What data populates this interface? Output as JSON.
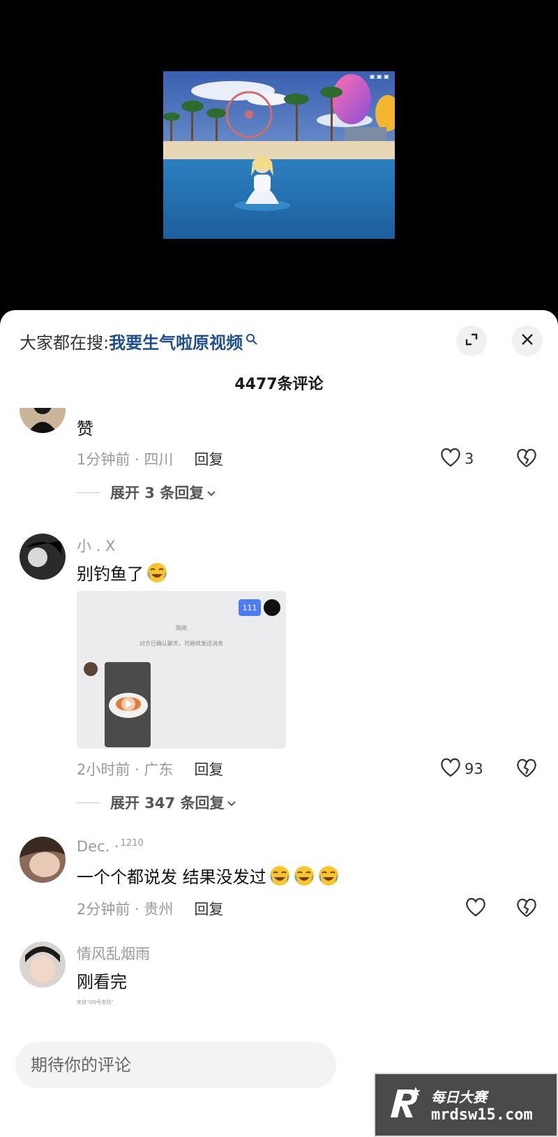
{
  "search": {
    "prefix": "大家都在搜:",
    "term": "我要生气啦原视频"
  },
  "comment_count": "4477条评论",
  "comments": [
    {
      "text": "赞",
      "time_location": "1分钟前 · 四川",
      "reply_label": "回复",
      "likes": "3",
      "expand_label": "展开 3 条回复"
    },
    {
      "username": "小 . X",
      "text": "别钓鱼了",
      "time_location": "2小时前 · 广东",
      "reply_label": "回复",
      "likes": "93",
      "expand_label": "展开 347 条回复",
      "attachment": {
        "badge": "111",
        "title": "刚刚",
        "notice": "对方已确认聊天，可继续发送消息"
      }
    },
    {
      "username": "Dec. ·",
      "username_badge": "1210",
      "text": "一个个都说发 结果没发过",
      "time_location": "2分钟前 · 贵州",
      "reply_label": "回复",
      "likes": ""
    },
    {
      "username": "情风乱烟雨",
      "text": "刚看完",
      "attachment_snippet": "来自\"QQ号查找\""
    }
  ],
  "input": {
    "placeholder": "期待你的评论"
  },
  "watermark": {
    "line1": "每日大赛",
    "line2": "mrdsw15.com"
  },
  "icons": {
    "search": "search-icon",
    "expand": "expand-icon",
    "close": "close-icon",
    "like": "heart-icon",
    "dislike": "broken-heart-icon",
    "chevron": "chevron-down-icon",
    "emoji": "crying-laughing-emoji"
  },
  "colors": {
    "search_term": "#1f4e8c",
    "muted_text": "#999999",
    "sheet_bg": "#ffffff",
    "badge_blue": "#4f7cf0"
  }
}
